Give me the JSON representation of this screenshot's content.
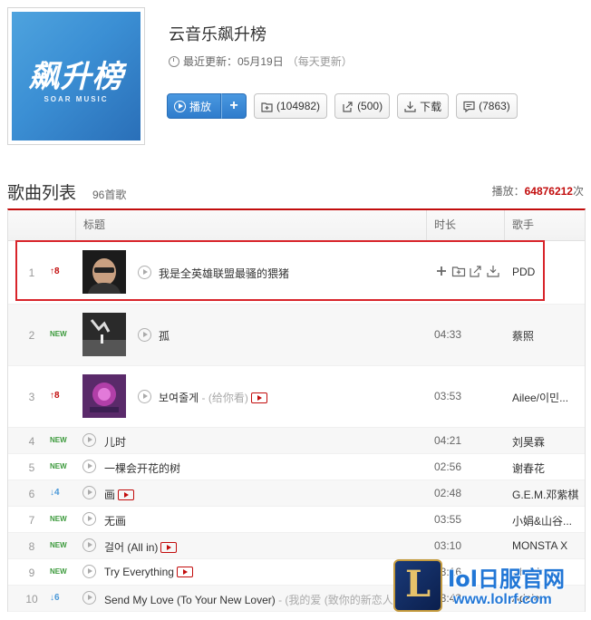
{
  "playlist": {
    "cover_title": "飙升榜",
    "cover_subtitle": "SOAR MUSIC",
    "title": "云音乐飙升榜",
    "update_label": "最近更新：05月19日",
    "update_note": "（每天更新）"
  },
  "actions": {
    "play": "播放",
    "add": "+",
    "collect": "(104982)",
    "share": "(500)",
    "download": "下载",
    "comment": "(7863)"
  },
  "songlist": {
    "title": "歌曲列表",
    "count": "96首歌",
    "plays_label": "播放：",
    "plays_value": "64876212",
    "plays_unit": "次",
    "col_title": "标题",
    "col_duration": "时长",
    "col_artist": "歌手"
  },
  "songs": [
    {
      "rank": "1",
      "change": "↑8",
      "name": "我是全英雄联盟最骚的猥猪",
      "alias": "",
      "mv": false,
      "duration": "",
      "artist": "PDD"
    },
    {
      "rank": "2",
      "change": "NEW",
      "name": "孤",
      "alias": "",
      "mv": false,
      "duration": "04:33",
      "artist": "蔡照"
    },
    {
      "rank": "3",
      "change": "↑8",
      "name": "보여줄게",
      "alias": " - (给你看)",
      "mv": true,
      "duration": "03:53",
      "artist": "Ailee/이민..."
    },
    {
      "rank": "4",
      "change": "NEW",
      "name": "儿时",
      "alias": "",
      "mv": false,
      "duration": "04:21",
      "artist": "刘昊霖"
    },
    {
      "rank": "5",
      "change": "NEW",
      "name": "一棵会开花的树",
      "alias": "",
      "mv": false,
      "duration": "02:56",
      "artist": "谢春花"
    },
    {
      "rank": "6",
      "change": "↓4",
      "name": "画",
      "alias": "",
      "mv": true,
      "duration": "02:48",
      "artist": "G.E.M.邓紫棋"
    },
    {
      "rank": "7",
      "change": "NEW",
      "name": "无画",
      "alias": "",
      "mv": false,
      "duration": "03:55",
      "artist": "小娟&山谷..."
    },
    {
      "rank": "8",
      "change": "NEW",
      "name": "걸어 (All in)",
      "alias": "",
      "mv": true,
      "duration": "03:10",
      "artist": "MONSTA X"
    },
    {
      "rank": "9",
      "change": "NEW",
      "name": "Try Everything",
      "alias": "",
      "mv": true,
      "duration": "03:16",
      "artist": "Shakira"
    },
    {
      "rank": "10",
      "change": "↓6",
      "name": "Send My Love (To Your New Lover)",
      "alias": " - (我的爱 (致你的新恋人))",
      "mv": false,
      "duration": "03:43",
      "artist": "Adele"
    }
  ],
  "watermark": {
    "logo_letter": "L",
    "line1": "lol日服官网",
    "line2": "www.lolrf.com"
  }
}
